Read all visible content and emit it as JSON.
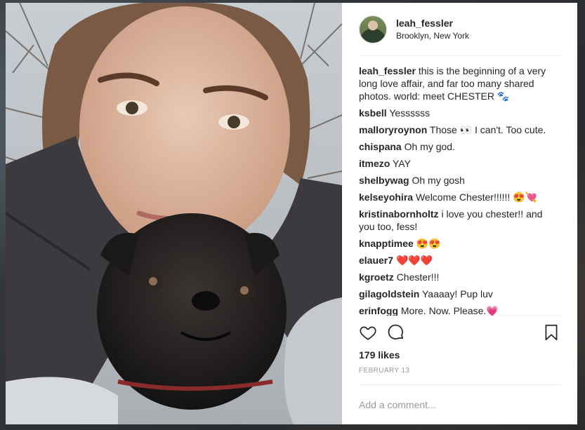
{
  "post": {
    "username": "leah_fessler",
    "location": "Brooklyn, New York",
    "likes": "179 likes",
    "date": "FEBRUARY 13",
    "add_comment_placeholder": "Add a comment..."
  },
  "comments": [
    {
      "user": "leah_fessler",
      "text": "this is the beginning of a very long love affair, and far too many shared photos. world: meet CHESTER 🐾"
    },
    {
      "user": "ksbell",
      "text": "Yessssss"
    },
    {
      "user": "malloryroynon",
      "text": "Those 👀 I can't. Too cute."
    },
    {
      "user": "chispana",
      "text": "Oh my god."
    },
    {
      "user": "itmezo",
      "text": "YAY"
    },
    {
      "user": "shelbywag",
      "text": "Oh my gosh"
    },
    {
      "user": "kelseyohira",
      "text": "Welcome Chester!!!!!! 😍💘"
    },
    {
      "user": "kristinabornholtz",
      "text": "i love you chester!! and you too, fess!"
    },
    {
      "user": "knapptimee",
      "text": "😍😍"
    },
    {
      "user": "elauer7",
      "text": "❤️❤️❤️"
    },
    {
      "user": "kgroetz",
      "text": "Chester!!!"
    },
    {
      "user": "gilagoldstein",
      "text": "Yaaaay! Pup luv"
    },
    {
      "user": "erinfogg",
      "text": "More. Now. Please.💗"
    }
  ],
  "icons": {
    "like": "heart-icon",
    "comment": "speech-bubble-icon",
    "save": "bookmark-icon"
  }
}
